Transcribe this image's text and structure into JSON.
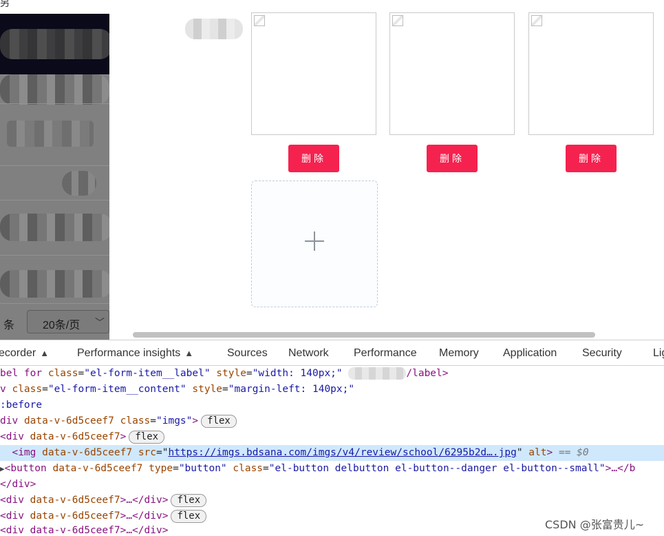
{
  "top": {
    "glyph": "另"
  },
  "sidebar": {
    "pager_label": "条",
    "page_size": "20条/页",
    "chevron": "﹀"
  },
  "gallery": {
    "delete_label": "删除",
    "items": [
      {
        "alt": ""
      },
      {
        "alt": ""
      },
      {
        "alt": ""
      }
    ],
    "uploader_symbol": "+"
  },
  "devtools": {
    "tabs": [
      "ecorder",
      "Performance insights",
      "Sources",
      "Network",
      "Performance",
      "Memory",
      "Application",
      "Security",
      "Lig"
    ],
    "lines": {
      "l1_tag_open": "bel for",
      "l1_attr1": "class",
      "l1_val1": "\"el-form-item__label\"",
      "l1_attr2": "style",
      "l1_val2": "\"width: 140px;\"",
      "l1_close": "/label>",
      "l2_tag": "v",
      "l2_attr1": "class",
      "l2_val1": "\"el-form-item__content\"",
      "l2_attr2": "style",
      "l2_val2": "\"margin-left: 140px;\"",
      "l3_text": ":before",
      "l4_tag": "div",
      "l4_attr1": "data-v-6d5ceef7",
      "l4_attr2": "class",
      "l4_val2": "\"imgs\"",
      "l5_tag": "<div",
      "l5_attr1": "data-v-6d5ceef7",
      "l6_tag": "<img",
      "l6_attr1": "data-v-6d5ceef7",
      "l6_attr2": "src",
      "l6_link": "https://imgs.bdsana.com/imgs/v4/review/school/6295b2d….jpg",
      "l6_attr3": "alt",
      "l6_eq": "== $0",
      "l7_tag": "<button",
      "l7_attr1": "data-v-6d5ceef7",
      "l7_attr2": "type",
      "l7_val2": "\"button\"",
      "l7_attr3": "class",
      "l7_val3": "\"el-button delbutton el-button--danger el-button--small\"",
      "l7_tail": ">…</b",
      "l8_tag": "</div>",
      "l9_tag": "<div",
      "l9_attr": "data-v-6d5ceef7",
      "l9_tail": ">…</div>",
      "l10_tag": "<div",
      "l10_attr": "data-v-6d5ceef7",
      "l10_tail": ">…</div>",
      "l11_partial": "<div data-v-6d5ceef7>…</div>"
    },
    "badge_flex": "flex"
  },
  "watermark": "CSDN @张富贵儿~",
  "colors": {
    "danger": "#f5224f",
    "selected_line": "#cfe8fc"
  }
}
